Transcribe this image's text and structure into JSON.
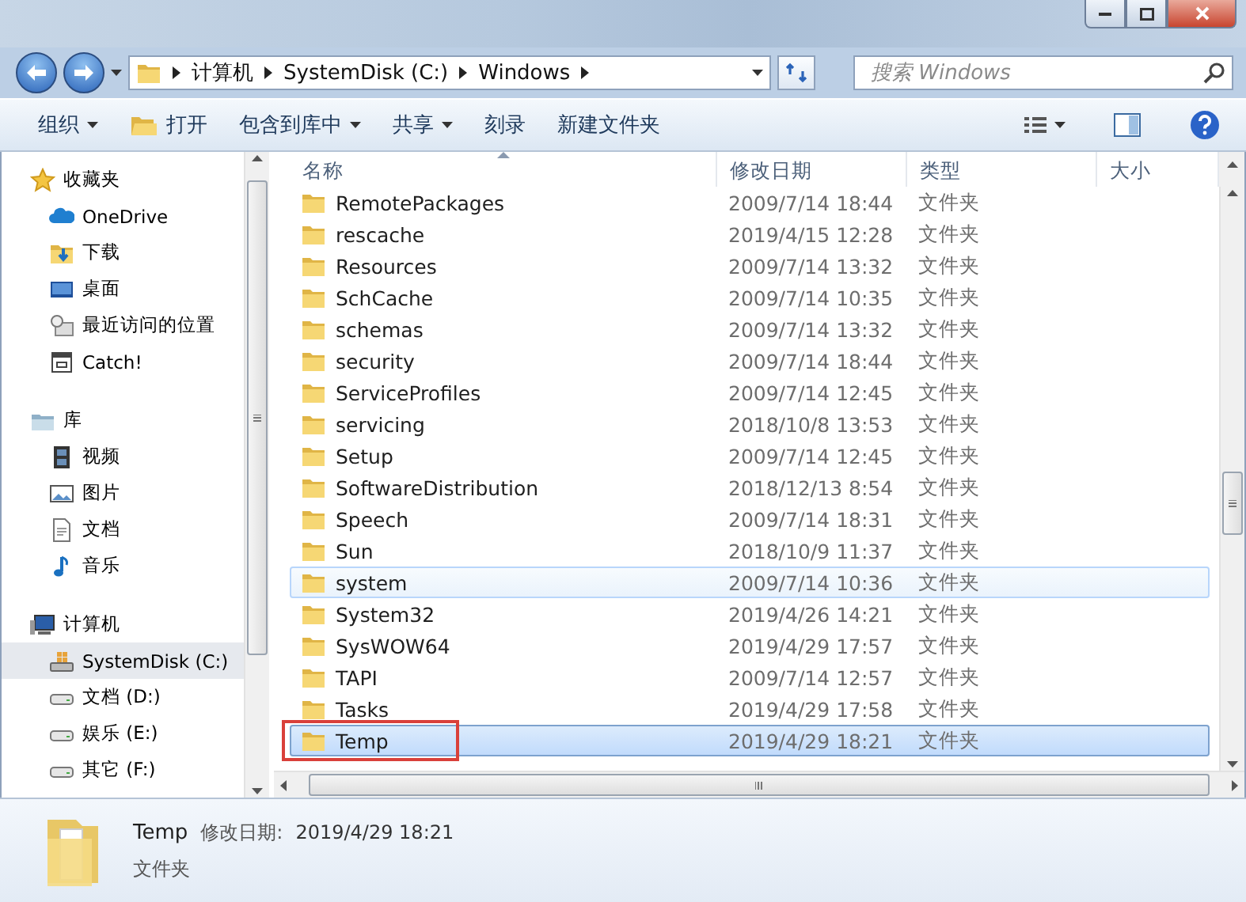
{
  "address_bar": {
    "segments": [
      "计算机",
      "SystemDisk (C:)",
      "Windows"
    ]
  },
  "search": {
    "placeholder": "搜索 Windows"
  },
  "toolbar": {
    "buttons": [
      {
        "label": "组织",
        "kind": "menu"
      },
      {
        "label": "打开",
        "kind": "icon"
      },
      {
        "label": "包含到库中",
        "kind": "menu"
      },
      {
        "label": "共享",
        "kind": "menu"
      },
      {
        "label": "刻录",
        "kind": "plain"
      },
      {
        "label": "新建文件夹",
        "kind": "plain"
      }
    ]
  },
  "sidebar": {
    "groups": [
      {
        "label": "收藏夹",
        "selected": false,
        "children": [
          {
            "label": "OneDrive",
            "selected": false
          },
          {
            "label": "下载",
            "selected": false
          },
          {
            "label": "桌面",
            "selected": false
          },
          {
            "label": "最近访问的位置",
            "selected": false
          },
          {
            "label": "Catch!",
            "selected": false
          }
        ]
      },
      {
        "label": "库",
        "selected": false,
        "children": [
          {
            "label": "视频",
            "selected": false
          },
          {
            "label": "图片",
            "selected": false
          },
          {
            "label": "文档",
            "selected": false
          },
          {
            "label": "音乐",
            "selected": false
          }
        ]
      },
      {
        "label": "计算机",
        "selected": false,
        "children": [
          {
            "label": "SystemDisk (C:)",
            "selected": true
          },
          {
            "label": "文档 (D:)",
            "selected": false
          },
          {
            "label": "娱乐 (E:)",
            "selected": false
          },
          {
            "label": "其它 (F:)",
            "selected": false
          }
        ]
      }
    ]
  },
  "file_list": {
    "columns": [
      {
        "label": "名称",
        "sorted": true
      },
      {
        "label": "修改日期",
        "sorted": false
      },
      {
        "label": "类型",
        "sorted": false
      },
      {
        "label": "大小",
        "sorted": false
      }
    ],
    "rows": [
      {
        "name": "RemotePackages",
        "modified": "2009/7/14 18:44",
        "type": "文件夹",
        "selected": false,
        "hovered": false,
        "marked": false
      },
      {
        "name": "rescache",
        "modified": "2019/4/15 12:28",
        "type": "文件夹",
        "selected": false,
        "hovered": false,
        "marked": false
      },
      {
        "name": "Resources",
        "modified": "2009/7/14 13:32",
        "type": "文件夹",
        "selected": false,
        "hovered": false,
        "marked": false
      },
      {
        "name": "SchCache",
        "modified": "2009/7/14 10:35",
        "type": "文件夹",
        "selected": false,
        "hovered": false,
        "marked": false
      },
      {
        "name": "schemas",
        "modified": "2009/7/14 13:32",
        "type": "文件夹",
        "selected": false,
        "hovered": false,
        "marked": false
      },
      {
        "name": "security",
        "modified": "2009/7/14 18:44",
        "type": "文件夹",
        "selected": false,
        "hovered": false,
        "marked": false
      },
      {
        "name": "ServiceProfiles",
        "modified": "2009/7/14 12:45",
        "type": "文件夹",
        "selected": false,
        "hovered": false,
        "marked": false
      },
      {
        "name": "servicing",
        "modified": "2018/10/8 13:53",
        "type": "文件夹",
        "selected": false,
        "hovered": false,
        "marked": false
      },
      {
        "name": "Setup",
        "modified": "2009/7/14 12:45",
        "type": "文件夹",
        "selected": false,
        "hovered": false,
        "marked": false
      },
      {
        "name": "SoftwareDistribution",
        "modified": "2018/12/13 8:54",
        "type": "文件夹",
        "selected": false,
        "hovered": false,
        "marked": false
      },
      {
        "name": "Speech",
        "modified": "2009/7/14 18:31",
        "type": "文件夹",
        "selected": false,
        "hovered": false,
        "marked": false
      },
      {
        "name": "Sun",
        "modified": "2018/10/9 11:37",
        "type": "文件夹",
        "selected": false,
        "hovered": false,
        "marked": false
      },
      {
        "name": "system",
        "modified": "2009/7/14 10:36",
        "type": "文件夹",
        "selected": false,
        "hovered": true,
        "marked": false
      },
      {
        "name": "System32",
        "modified": "2019/4/26 14:21",
        "type": "文件夹",
        "selected": false,
        "hovered": false,
        "marked": false
      },
      {
        "name": "SysWOW64",
        "modified": "2019/4/29 17:57",
        "type": "文件夹",
        "selected": false,
        "hovered": false,
        "marked": false
      },
      {
        "name": "TAPI",
        "modified": "2009/7/14 12:57",
        "type": "文件夹",
        "selected": false,
        "hovered": false,
        "marked": false
      },
      {
        "name": "Tasks",
        "modified": "2019/4/29 17:58",
        "type": "文件夹",
        "selected": false,
        "hovered": false,
        "marked": false
      },
      {
        "name": "Temp",
        "modified": "2019/4/29 18:21",
        "type": "文件夹",
        "selected": true,
        "hovered": false,
        "marked": true
      }
    ]
  },
  "details": {
    "name": "Temp",
    "modified_label": "修改日期:",
    "modified": "2019/4/29 18:21",
    "type": "文件夹"
  }
}
